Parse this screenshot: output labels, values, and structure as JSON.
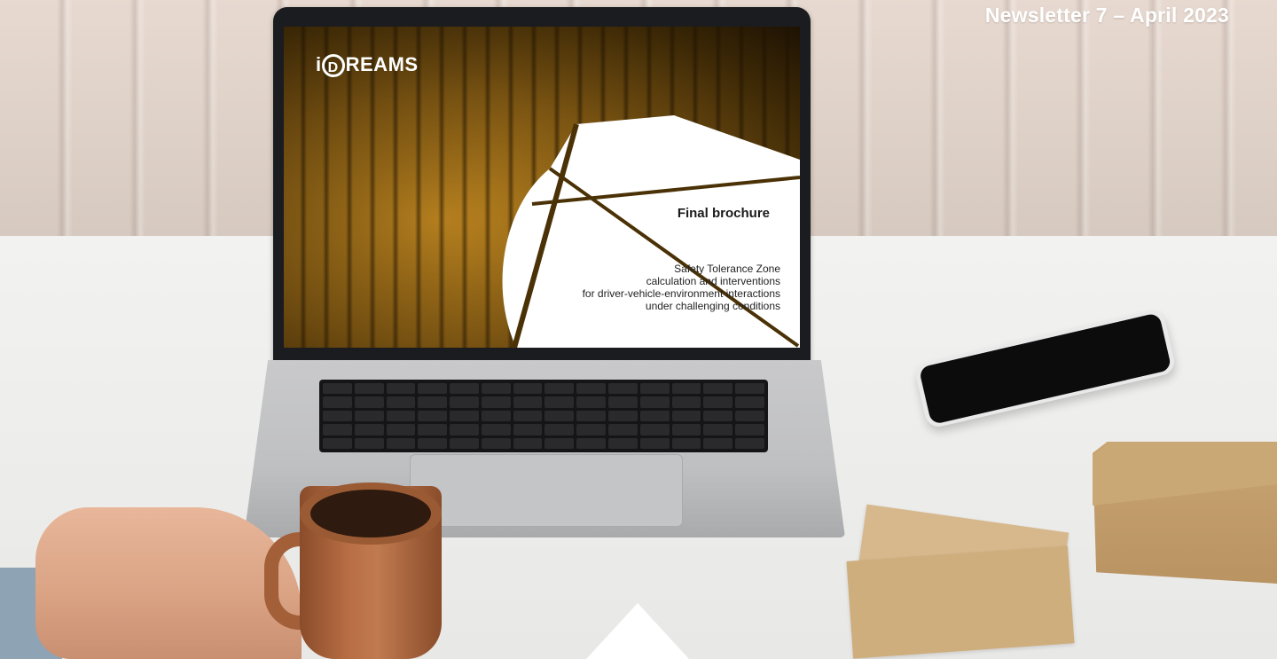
{
  "header": {
    "newsletter_label": "Newsletter 7 – April 2023"
  },
  "laptop_screen": {
    "logo_prefix": "i",
    "logo_ring_letter": "D",
    "logo_rest": "REAMS",
    "title": "Final brochure",
    "subtitle_lines": [
      "Safety Tolerance Zone",
      "calculation and interventions",
      "for driver-vehicle-environment interactions",
      "under challenging conditions"
    ]
  },
  "colors": {
    "accent_gold": "#b9821f",
    "background_desk": "#f2f2f0",
    "text_white": "#ffffff"
  },
  "icons": {
    "scroll_indicator": "triangle-up-icon"
  }
}
